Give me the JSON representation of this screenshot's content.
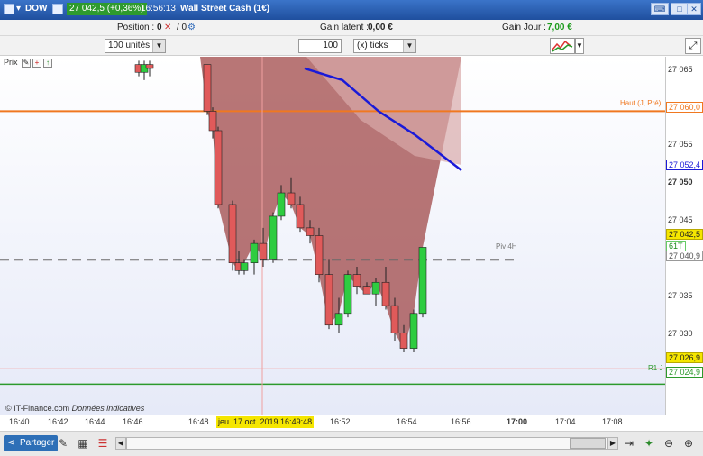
{
  "window": {
    "symbol": "DOW",
    "price_chip": "27 042,5 (+0,36%)",
    "time": "16:56:13",
    "instrument": "Wall Street Cash (1€)"
  },
  "info": {
    "position_label": "Position :",
    "position_value": "0",
    "position_sep": "/ 0",
    "gain_latent_label": "Gain latent :",
    "gain_latent_value": "0,00 €",
    "gain_jour_label": "Gain Jour :",
    "gain_jour_value": "7,00 €"
  },
  "controls": {
    "units": "100 unités",
    "ticks_value": "100",
    "ticks_unit": "(x) ticks"
  },
  "chart_header": {
    "prix": "Prix"
  },
  "y_axis": {
    "ticks": [
      "27 065",
      "27 060,0",
      "27 055",
      "27 052,4",
      "27 050",
      "27 045",
      "27 042,5",
      "61T",
      "27 040,9",
      "27 035",
      "27 030",
      "27 026,9",
      "27 024,9"
    ]
  },
  "annotations": {
    "haut": "Haut (J, Pré)",
    "piv": "Piv 4H",
    "r1": "R1 J"
  },
  "x_axis": {
    "ticks": [
      "16:40",
      "16:42",
      "16:44",
      "16:46",
      "16:48",
      "16:52",
      "16:54",
      "16:56",
      "17:00",
      "17:04",
      "17:08"
    ],
    "cursor_time": "jeu. 17 oct. 2019 16:49:48"
  },
  "footer": {
    "source": "© IT-Finance.com",
    "note": "Données indicatives"
  },
  "bottom": {
    "share": "Partager"
  },
  "colors": {
    "up": "#2ecc40",
    "down": "#e05a5a",
    "ma": "#1a1ad8",
    "haut": "#f07820",
    "r1": "#2c9a2c",
    "fill": "#a04848"
  },
  "chart_data": {
    "type": "candlestick",
    "x": [
      "16:46",
      "16:46",
      "16:46",
      "16:48",
      "16:48",
      "16:48",
      "16:49",
      "16:49",
      "16:49",
      "16:50",
      "16:50",
      "16:50",
      "16:51",
      "16:51",
      "16:51",
      "16:52",
      "16:52",
      "16:52",
      "16:53",
      "16:53",
      "16:53",
      "16:54",
      "16:54",
      "16:55",
      "16:55",
      "16:55",
      "16:56",
      "16:56"
    ],
    "ohlc": [
      [
        27066.0,
        27066.5,
        27064.5,
        27065.0
      ],
      [
        27065.0,
        27066.5,
        27064.0,
        27066.0
      ],
      [
        27066.0,
        27066.5,
        27064.5,
        27065.5
      ],
      [
        27066.0,
        27066.0,
        27059.5,
        27060.0
      ],
      [
        27060.0,
        27060.5,
        27056.5,
        27057.5
      ],
      [
        27057.5,
        27058.0,
        27047.5,
        27048.0
      ],
      [
        27048.0,
        27048.5,
        27039.5,
        27040.5
      ],
      [
        27040.5,
        27042.0,
        27039.0,
        27039.5
      ],
      [
        27039.5,
        27041.0,
        27039.0,
        27040.5
      ],
      [
        27040.5,
        27043.5,
        27039.0,
        27043.0
      ],
      [
        27043.0,
        27045.0,
        27040.0,
        27041.0
      ],
      [
        27041.0,
        27047.0,
        27040.5,
        27046.5
      ],
      [
        27046.5,
        27050.5,
        27046.0,
        27049.5
      ],
      [
        27049.5,
        27051.5,
        27047.5,
        27048.0
      ],
      [
        27048.0,
        27049.0,
        27044.5,
        27045.0
      ],
      [
        27045.0,
        27046.0,
        27043.0,
        27044.0
      ],
      [
        27044.0,
        27045.0,
        27038.0,
        27039.0
      ],
      [
        27039.0,
        27041.0,
        27032.0,
        27032.5
      ],
      [
        27032.5,
        27036.0,
        27031.5,
        27034.0
      ],
      [
        27034.0,
        27039.5,
        27033.5,
        27039.0
      ],
      [
        27039.0,
        27040.0,
        27036.5,
        27037.5
      ],
      [
        27037.5,
        27038.0,
        27036.5,
        27036.5
      ],
      [
        27036.5,
        27038.5,
        27035.0,
        27038.0
      ],
      [
        27038.0,
        27040.0,
        27034.5,
        27035.0
      ],
      [
        27035.0,
        27036.0,
        27030.5,
        27031.5
      ],
      [
        27031.5,
        27032.5,
        27029.0,
        27029.5
      ],
      [
        27029.5,
        27034.5,
        27029.0,
        27034.0
      ],
      [
        27034.0,
        27042.5,
        27033.5,
        27042.5
      ]
    ],
    "moving_average": [
      [
        27066.0,
        27065.5
      ],
      [
        27064.0,
        27064.0
      ],
      [
        27061.0,
        27060.0
      ],
      [
        27057.5,
        27057.0
      ],
      [
        27053.5,
        27052.4
      ]
    ],
    "levels": {
      "haut_j_pre": 27060.0,
      "piv_4h": 27040.9,
      "r1_j": 27024.9,
      "current": 27042.5
    },
    "ylim": [
      27021.0,
      27067.0
    ],
    "grid": false
  }
}
